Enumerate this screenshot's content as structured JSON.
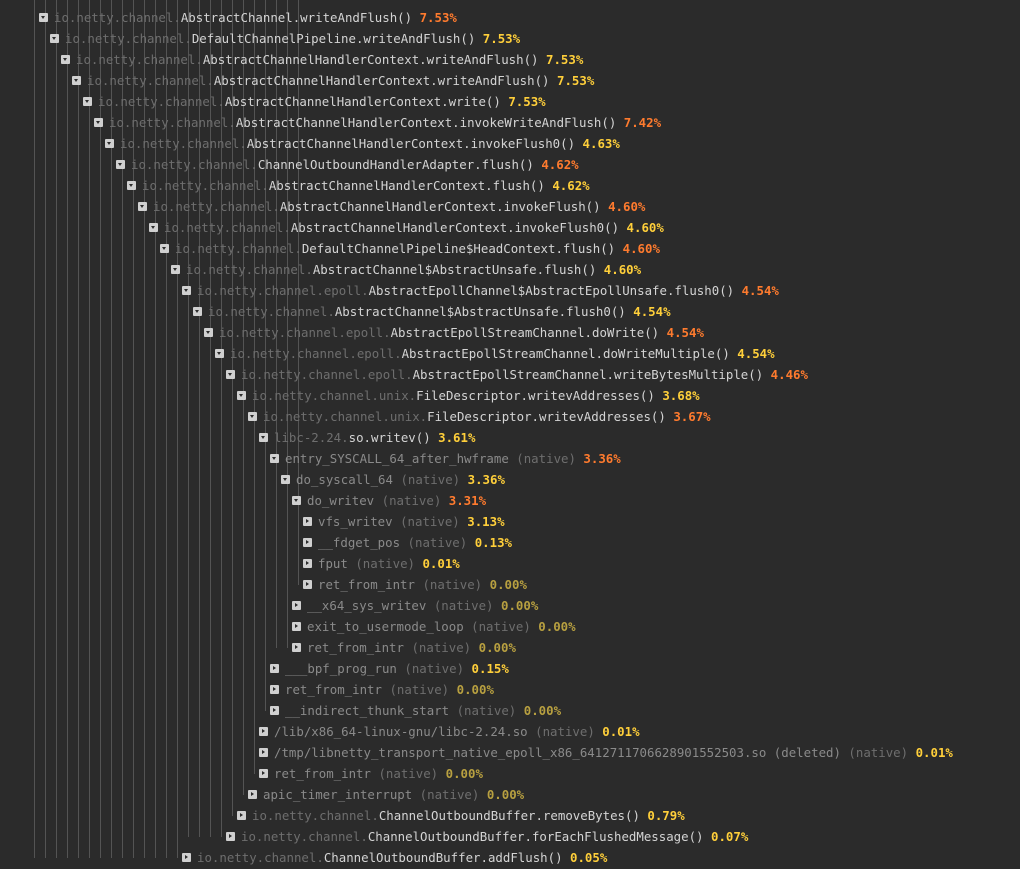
{
  "rows": [
    {
      "pkg": "io.netty.channel.",
      "name": "AbstractChannel.writeAndFlush()",
      "pct": "7.53%",
      "color": "#ff7b2e",
      "depth": 0,
      "state": "exp"
    },
    {
      "pkg": "io.netty.channel.",
      "name": "DefaultChannelPipeline.writeAndFlush()",
      "pct": "7.53%",
      "color": "#ffcf3a",
      "depth": 1,
      "state": "exp"
    },
    {
      "pkg": "io.netty.channel.",
      "name": "AbstractChannelHandlerContext.writeAndFlush()",
      "pct": "7.53%",
      "color": "#ffcf3a",
      "depth": 2,
      "state": "exp"
    },
    {
      "pkg": "io.netty.channel.",
      "name": "AbstractChannelHandlerContext.writeAndFlush()",
      "pct": "7.53%",
      "color": "#ffcf3a",
      "depth": 3,
      "state": "exp"
    },
    {
      "pkg": "io.netty.channel.",
      "name": "AbstractChannelHandlerContext.write()",
      "pct": "7.53%",
      "color": "#ffcf3a",
      "depth": 4,
      "state": "exp"
    },
    {
      "pkg": "io.netty.channel.",
      "name": "AbstractChannelHandlerContext.invokeWriteAndFlush()",
      "pct": "7.42%",
      "color": "#ff7b2e",
      "depth": 5,
      "state": "exp"
    },
    {
      "pkg": "io.netty.channel.",
      "name": "AbstractChannelHandlerContext.invokeFlush0()",
      "pct": "4.63%",
      "color": "#ffcf3a",
      "depth": 6,
      "state": "exp"
    },
    {
      "pkg": "io.netty.channel.",
      "name": "ChannelOutboundHandlerAdapter.flush()",
      "pct": "4.62%",
      "color": "#ff7b2e",
      "depth": 7,
      "state": "exp"
    },
    {
      "pkg": "io.netty.channel.",
      "name": "AbstractChannelHandlerContext.flush()",
      "pct": "4.62%",
      "color": "#ffcf3a",
      "depth": 8,
      "state": "exp"
    },
    {
      "pkg": "io.netty.channel.",
      "name": "AbstractChannelHandlerContext.invokeFlush()",
      "pct": "4.60%",
      "color": "#ff7b2e",
      "depth": 9,
      "state": "exp"
    },
    {
      "pkg": "io.netty.channel.",
      "name": "AbstractChannelHandlerContext.invokeFlush0()",
      "pct": "4.60%",
      "color": "#ffcf3a",
      "depth": 10,
      "state": "exp"
    },
    {
      "pkg": "io.netty.channel.",
      "name": "DefaultChannelPipeline$HeadContext.flush()",
      "pct": "4.60%",
      "color": "#ff7b2e",
      "depth": 11,
      "state": "exp"
    },
    {
      "pkg": "io.netty.channel.",
      "name": "AbstractChannel$AbstractUnsafe.flush()",
      "pct": "4.60%",
      "color": "#ffcf3a",
      "depth": 12,
      "state": "exp"
    },
    {
      "pkg": "io.netty.channel.epoll.",
      "name": "AbstractEpollChannel$AbstractEpollUnsafe.flush0()",
      "pct": "4.54%",
      "color": "#ff7b2e",
      "depth": 13,
      "state": "exp"
    },
    {
      "pkg": "io.netty.channel.",
      "name": "AbstractChannel$AbstractUnsafe.flush0()",
      "pct": "4.54%",
      "color": "#ffcf3a",
      "depth": 14,
      "state": "exp"
    },
    {
      "pkg": "io.netty.channel.epoll.",
      "name": "AbstractEpollStreamChannel.doWrite()",
      "pct": "4.54%",
      "color": "#ff7b2e",
      "depth": 15,
      "state": "exp"
    },
    {
      "pkg": "io.netty.channel.epoll.",
      "name": "AbstractEpollStreamChannel.doWriteMultiple()",
      "pct": "4.54%",
      "color": "#ffcf3a",
      "depth": 16,
      "state": "exp"
    },
    {
      "pkg": "io.netty.channel.epoll.",
      "name": "AbstractEpollStreamChannel.writeBytesMultiple()",
      "pct": "4.46%",
      "color": "#ff7b2e",
      "depth": 17,
      "state": "exp"
    },
    {
      "pkg": "io.netty.channel.unix.",
      "name": "FileDescriptor.writevAddresses()",
      "pct": "3.68%",
      "color": "#ffcf3a",
      "depth": 18,
      "state": "exp"
    },
    {
      "pkg": "io.netty.channel.unix.",
      "name": "FileDescriptor.writevAddresses()",
      "pct": "3.67%",
      "color": "#ff7b2e",
      "depth": 19,
      "state": "exp"
    },
    {
      "pkg": "libc-2.24.",
      "name": "so.writev()",
      "pct": "3.61%",
      "color": "#ffcf3a",
      "depth": 20,
      "state": "exp"
    },
    {
      "pkg": "",
      "name": "entry_SYSCALL_64_after_hwframe",
      "kind": "(native)",
      "pct": "3.36%",
      "color": "#ff7b2e",
      "depth": 21,
      "state": "exp",
      "dim": true
    },
    {
      "pkg": "",
      "name": "do_syscall_64",
      "kind": "(native)",
      "pct": "3.36%",
      "color": "#ffcf3a",
      "depth": 22,
      "state": "exp",
      "dim": true
    },
    {
      "pkg": "",
      "name": "do_writev",
      "kind": "(native)",
      "pct": "3.31%",
      "color": "#ff7b2e",
      "depth": 23,
      "state": "exp",
      "dim": true
    },
    {
      "pkg": "",
      "name": "vfs_writev",
      "kind": "(native)",
      "pct": "3.13%",
      "color": "#ffcf3a",
      "depth": 24,
      "state": "col",
      "dim": true
    },
    {
      "pkg": "",
      "name": "__fdget_pos",
      "kind": "(native)",
      "pct": "0.13%",
      "color": "#ffcf3a",
      "depth": 24,
      "state": "col",
      "dim": true
    },
    {
      "pkg": "",
      "name": "fput",
      "kind": "(native)",
      "pct": "0.01%",
      "color": "#ffcf3a",
      "depth": 24,
      "state": "col",
      "dim": true
    },
    {
      "pkg": "",
      "name": "ret_from_intr",
      "kind": "(native)",
      "pct": "0.00%",
      "color": "#b8a040",
      "depth": 24,
      "state": "col",
      "dim": true
    },
    {
      "pkg": "",
      "name": "__x64_sys_writev",
      "kind": "(native)",
      "pct": "0.00%",
      "color": "#b8a040",
      "depth": 23,
      "state": "col",
      "dim": true
    },
    {
      "pkg": "",
      "name": "exit_to_usermode_loop",
      "kind": "(native)",
      "pct": "0.00%",
      "color": "#b8a040",
      "depth": 23,
      "state": "col",
      "dim": true
    },
    {
      "pkg": "",
      "name": "ret_from_intr",
      "kind": "(native)",
      "pct": "0.00%",
      "color": "#b8a040",
      "depth": 23,
      "state": "col",
      "dim": true
    },
    {
      "pkg": "",
      "name": "___bpf_prog_run",
      "kind": "(native)",
      "pct": "0.15%",
      "color": "#ffcf3a",
      "depth": 21,
      "state": "col",
      "dim": true
    },
    {
      "pkg": "",
      "name": "ret_from_intr",
      "kind": "(native)",
      "pct": "0.00%",
      "color": "#b8a040",
      "depth": 21,
      "state": "col",
      "dim": true
    },
    {
      "pkg": "",
      "name": "__indirect_thunk_start",
      "kind": "(native)",
      "pct": "0.00%",
      "color": "#b8a040",
      "depth": 21,
      "state": "col",
      "dim": true
    },
    {
      "pkg": "",
      "name": "/lib/x86_64-linux-gnu/libc-2.24.so",
      "kind": "(native)",
      "pct": "0.01%",
      "color": "#ffcf3a",
      "depth": 20,
      "state": "col",
      "dim": true
    },
    {
      "pkg": "",
      "name": "/tmp/libnetty_transport_native_epoll_x86_641271170662890155250З.so (deleted)",
      "kind": "(native)",
      "pct": "0.01%",
      "color": "#ffcf3a",
      "depth": 20,
      "state": "col",
      "dim": true
    },
    {
      "pkg": "",
      "name": "ret_from_intr",
      "kind": "(native)",
      "pct": "0.00%",
      "color": "#b8a040",
      "depth": 20,
      "state": "col",
      "dim": true
    },
    {
      "pkg": "",
      "name": "apic_timer_interrupt",
      "kind": "(native)",
      "pct": "0.00%",
      "color": "#b8a040",
      "depth": 19,
      "state": "col",
      "dim": true
    },
    {
      "pkg": "io.netty.channel.",
      "name": "ChannelOutboundBuffer.removeBytes()",
      "pct": "0.79%",
      "color": "#ffcf3a",
      "depth": 18,
      "state": "col"
    },
    {
      "pkg": "io.netty.channel.",
      "name": "ChannelOutboundBuffer.forEachFlushedMessage()",
      "pct": "0.07%",
      "color": "#ffcf3a",
      "depth": 17,
      "state": "col"
    },
    {
      "pkg": "io.netty.channel.",
      "name": "ChannelOutboundBuffer.addFlush()",
      "pct": "0.05%",
      "color": "#ffcf3a",
      "depth": 13,
      "state": "col"
    }
  ]
}
